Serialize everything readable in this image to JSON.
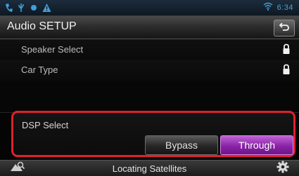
{
  "status_bar": {
    "icons_left": [
      "handset-icon",
      "usb-icon",
      "record-dot-icon",
      "warning-icon"
    ],
    "icons_right": [
      "wifi-icon"
    ],
    "time": "6:34"
  },
  "header": {
    "title": "Audio SETUP",
    "back_icon": "back-arrow-icon"
  },
  "settings": {
    "items": [
      {
        "label": "Speaker Select",
        "icon": "lock-icon"
      },
      {
        "label": "Car Type",
        "icon": "lock-icon"
      }
    ]
  },
  "dsp": {
    "label": "DSP Select",
    "options": [
      "Bypass",
      "Through"
    ],
    "selected": "Through",
    "highlight_color": "#e0202e",
    "selected_color": "#8a24a6"
  },
  "bottom_bar": {
    "left_icon": "nav-search-icon",
    "status_text": "Locating Satellites",
    "right_icon": "gear-icon"
  }
}
